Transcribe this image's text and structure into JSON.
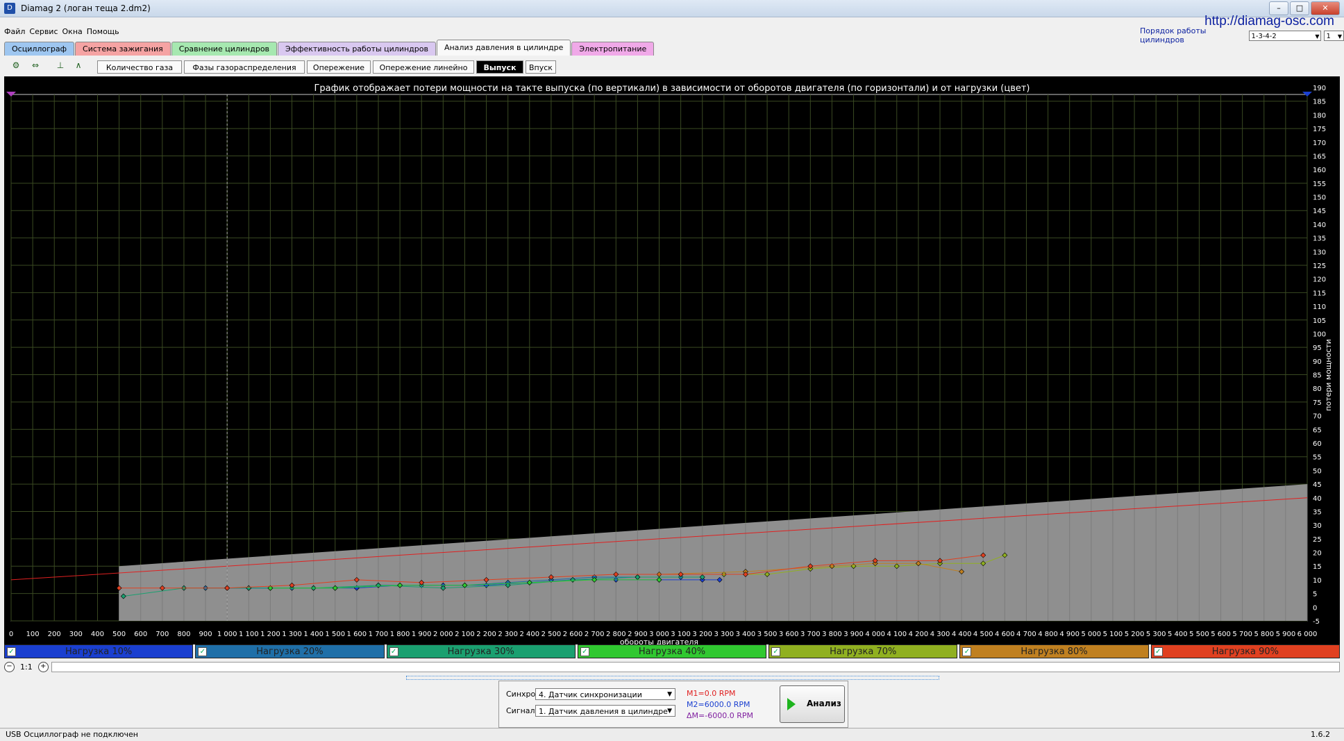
{
  "window": {
    "title": "Diamag 2 (логан теща 2.dm2)",
    "site": "http://diamag-osc.com"
  },
  "menu": [
    "Файл",
    "Сервис",
    "Окна",
    "Помощь"
  ],
  "cyl_order": {
    "label": "Порядок работы цилиндров",
    "value": "1-3-4-2",
    "index": "1"
  },
  "tabs": [
    {
      "label": "Осциллограф",
      "color": "#9ec6f0"
    },
    {
      "label": "Система зажигания",
      "color": "#f5a3a3"
    },
    {
      "label": "Сравнение цилиндров",
      "color": "#a6e8b0"
    },
    {
      "label": "Эффективность работы цилиндров",
      "color": "#d9c8f0"
    },
    {
      "label": "Анализ давления в цилиндре",
      "color": "#f9f9f9",
      "active": true
    },
    {
      "label": "Электропитание",
      "color": "#f0a9e8"
    }
  ],
  "subtabs": [
    {
      "label": "Количество газа"
    },
    {
      "label": "Фазы газораспределения"
    },
    {
      "label": "Опережение"
    },
    {
      "label": "Опережение линейно"
    },
    {
      "label": "Выпуск",
      "active": true
    },
    {
      "label": "Впуск"
    }
  ],
  "chart_data": {
    "type": "scatter",
    "title": "График отображает потери мощности на такте выпуска (по вертикали) в зависимости от оборотов двигателя (по горизонтали) и от нагрузки (цвет)",
    "xlabel": "обороты двигателя",
    "ylabel": "потери мощности",
    "xlim": [
      0,
      6000
    ],
    "ylim": [
      -5,
      190
    ],
    "x_tick_step": 100,
    "y_tick_step": 5,
    "grid": true,
    "cursor_x": 1000,
    "limit_line": {
      "x": [
        0,
        6000
      ],
      "y": [
        10,
        40
      ],
      "color": "#e02020"
    },
    "band": {
      "x_start": 500,
      "x_end": 6000,
      "y_low": -5,
      "y_high_start": 15,
      "y_high_end": 45
    },
    "series": [
      {
        "name": "Нагрузка 10%",
        "color": "#1a3fd0",
        "x": [
          1000,
          1200,
          1400,
          1600,
          1800,
          2000,
          2200,
          2400,
          2600,
          2800,
          3000,
          3200,
          3280
        ],
        "y": [
          7,
          7,
          7,
          7,
          8,
          8,
          8,
          9,
          10,
          10,
          10,
          10,
          10
        ]
      },
      {
        "name": "Нагрузка 20%",
        "color": "#1f6fa8",
        "x": [
          900,
          1100,
          1300,
          1500,
          1700,
          1900,
          2100,
          2300,
          2500,
          2700,
          2900,
          3100
        ],
        "y": [
          7,
          7,
          7,
          7,
          8,
          8,
          8,
          9,
          10,
          11,
          11,
          11
        ]
      },
      {
        "name": "Нагрузка 30%",
        "color": "#1aa070",
        "x": [
          520,
          800,
          1100,
          1400,
          1700,
          2000,
          2300,
          2600,
          2900,
          3200
        ],
        "y": [
          4,
          7,
          7,
          7,
          8,
          7,
          8,
          10,
          11,
          11
        ]
      },
      {
        "name": "Нагрузка 40%",
        "color": "#30c830",
        "x": [
          1200,
          1500,
          1800,
          2100,
          2400,
          2700,
          3000
        ],
        "y": [
          7,
          7,
          8,
          8,
          9,
          10,
          10
        ]
      },
      {
        "name": "Нагрузка 70%",
        "color": "#90b020",
        "x": [
          3300,
          3500,
          3700,
          3900,
          4100,
          4300,
          4500,
          4600
        ],
        "y": [
          12,
          12,
          14,
          15,
          15,
          16,
          16,
          19
        ]
      },
      {
        "name": "Нагрузка 80%",
        "color": "#c08020",
        "x": [
          3000,
          3400,
          3800,
          4000,
          4200,
          4400
        ],
        "y": [
          12,
          13,
          15,
          16,
          16,
          13
        ]
      },
      {
        "name": "Нагрузка 90%",
        "color": "#e04020",
        "x": [
          500,
          700,
          1000,
          1300,
          1600,
          1900,
          2200,
          2500,
          2800,
          3100,
          3400,
          3700,
          4000,
          4300,
          4500
        ],
        "y": [
          7,
          7,
          7,
          8,
          10,
          9,
          10,
          11,
          12,
          12,
          12,
          15,
          17,
          17,
          19
        ]
      }
    ]
  },
  "zoom": {
    "ratio": "1:1"
  },
  "controls": {
    "sync_label": "Синхро:",
    "sync_value": "4.  Датчик синхронизации",
    "signal_label": "Сигнал:",
    "signal_value": "1.  Датчик давления в цилиндре",
    "m1": "M1=0.0 RPM",
    "m2": "M2=6000.0 RPM",
    "dm": "ΔM=-6000.0 RPM",
    "run": "Анализ"
  },
  "status": {
    "text": "USB Осциллограф не подключен",
    "version": "1.6.2"
  }
}
